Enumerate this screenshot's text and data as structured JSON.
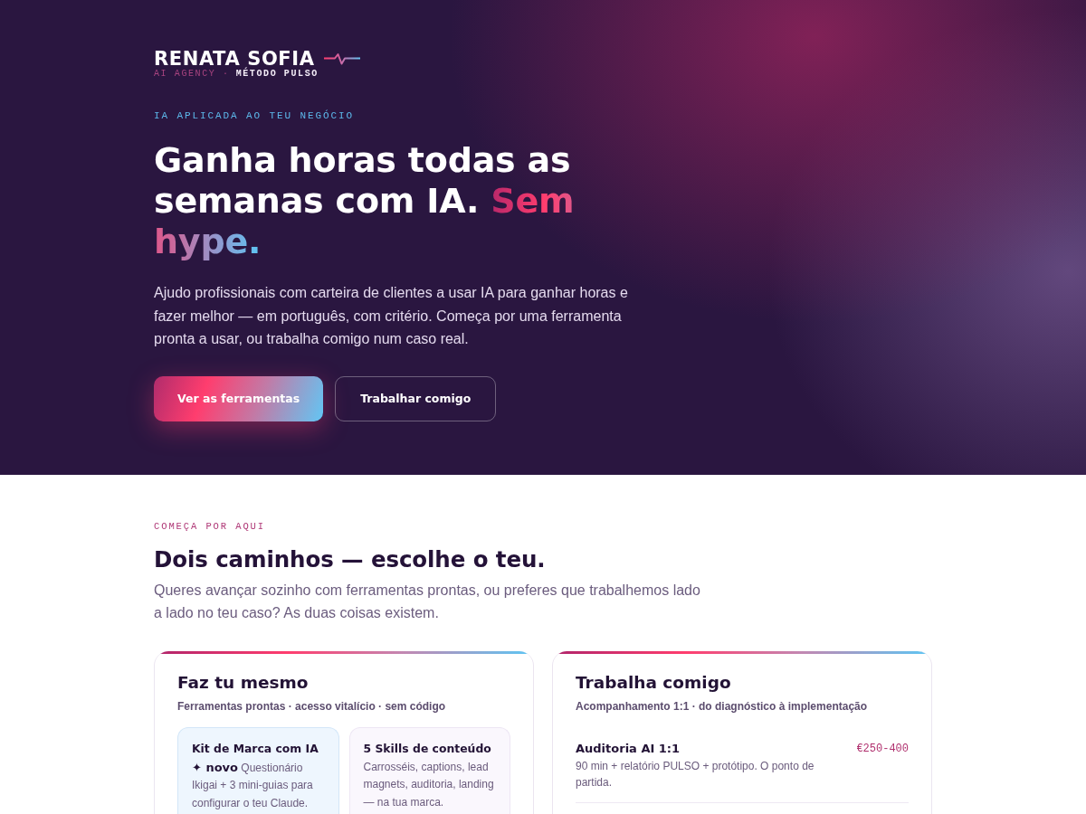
{
  "brand": {
    "name": "RENATA SOFIA",
    "tagline": "AI AGENCY ·",
    "method": "MÉTODO PULSO"
  },
  "hero": {
    "eyebrow": "IA APLICADA AO TEU NEGÓCIO",
    "headline": "Ganha horas todas as semanas com IA.",
    "headline_accent": "Sem hype.",
    "lead": "Ajudo profissionais com carteira de clientes a usar IA para ganhar horas e fazer melhor — em português, com critério. Começa por uma ferramenta pronta a usar, ou trabalha comigo num caso real.",
    "buttons": [
      {
        "label": "Ver as ferramentas",
        "kind": "primary"
      },
      {
        "label": "Trabalhar comigo",
        "kind": "secondary"
      }
    ]
  },
  "paths": {
    "eyebrow": "COMEÇA POR AQUI",
    "title": "Dois caminhos — escolhe o teu.",
    "subtitle": "Queres avançar sozinho com ferramentas prontas, ou preferes que trabalhemos lado a lado no teu caso? As duas coisas existem.",
    "cards": [
      {
        "kind": "products",
        "title": "Faz tu mesmo",
        "subtitle": "Ferramentas prontas · acesso vitalício · sem código",
        "products": [
          {
            "title": "Kit de Marca com IA",
            "description": "**✦ novo** Questionário Ikigai + 3 mini-guias para configurar o teu Claude.",
            "featured": true
          },
          {
            "title": "5 Skills de conteúdo",
            "description": "Carrosséis, captions, lead magnets, auditoria, landing — na tua marca.",
            "featured": false
          }
        ]
      },
      {
        "kind": "services",
        "title": "Trabalha comigo",
        "subtitle": "Acompanhamento 1:1 · do diagnóstico à implementação",
        "services": [
          {
            "name": "Auditoria AI 1:1",
            "price": "€250-400",
            "description": "90 min + relatório PULSO + protótipo. O ponto de partida."
          }
        ]
      }
    ]
  }
}
